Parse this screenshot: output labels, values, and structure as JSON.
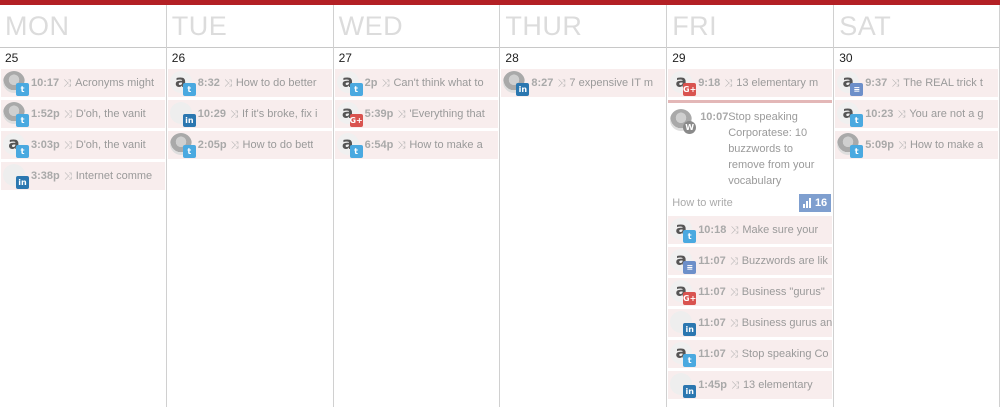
{
  "days": [
    {
      "name": "MON",
      "num": "25",
      "posts": [
        {
          "time": "10:17",
          "text": "Acronyms might",
          "avatar": "photo",
          "network": "twitter"
        },
        {
          "time": "1:52p",
          "text": "D'oh, the vanit",
          "avatar": "photo",
          "network": "twitter"
        },
        {
          "time": "3:03p",
          "text": "D'oh, the vanit",
          "avatar": "a",
          "network": "twitter"
        },
        {
          "time": "3:38p",
          "text": "Internet comme",
          "avatar": "logo",
          "network": "linkedin"
        }
      ]
    },
    {
      "name": "TUE",
      "num": "26",
      "posts": [
        {
          "time": "8:32",
          "text": "How to do better",
          "avatar": "a",
          "network": "twitter"
        },
        {
          "time": "10:29",
          "text": "If it's broke, fix i",
          "avatar": "logo",
          "network": "linkedin"
        },
        {
          "time": "2:05p",
          "text": "How to do bett",
          "avatar": "photo",
          "network": "twitter"
        }
      ]
    },
    {
      "name": "WED",
      "num": "27",
      "posts": [
        {
          "time": "2p",
          "text": "Can't think what to",
          "avatar": "a",
          "network": "twitter"
        },
        {
          "time": "5:39p",
          "text": "'Everything that",
          "avatar": "a",
          "network": "gplus"
        },
        {
          "time": "6:54p",
          "text": "How to make a",
          "avatar": "a",
          "network": "twitter"
        }
      ]
    },
    {
      "name": "THUR",
      "num": "28",
      "posts": [
        {
          "time": "8:27",
          "text": "7 expensive IT m",
          "avatar": "photo",
          "network": "linkedin"
        }
      ]
    },
    {
      "name": "FRI",
      "num": "29",
      "posts_before": [
        {
          "time": "9:18",
          "text": "13 elementary m",
          "avatar": "a",
          "network": "gplus"
        }
      ],
      "featured": {
        "time": "10:07",
        "text": "Stop speaking Corporatese: 10 buzzwords to remove from your vocabulary",
        "footer_label": "How to write",
        "stat": "16",
        "network": "wordpress"
      },
      "posts_after": [
        {
          "time": "10:18",
          "text": "Make sure your",
          "avatar": "a",
          "network": "twitter"
        },
        {
          "time": "11:07",
          "text": "Buzzwords are lik",
          "avatar": "a",
          "network": "buffer"
        },
        {
          "time": "11:07",
          "text": "Business \"gurus\"",
          "avatar": "a",
          "network": "gplus"
        },
        {
          "time": "11:07",
          "text": "Business gurus an",
          "avatar": "logo",
          "network": "linkedin"
        },
        {
          "time": "11:07",
          "text": "Stop speaking Co",
          "avatar": "a",
          "network": "twitter"
        },
        {
          "time": "1:45p",
          "text": "13 elementary",
          "avatar": "logo",
          "network": "linkedin"
        }
      ]
    },
    {
      "name": "SAT",
      "num": "30",
      "posts": [
        {
          "time": "9:37",
          "text": "The REAL trick t",
          "avatar": "a",
          "network": "buffer"
        },
        {
          "time": "10:23",
          "text": "You are not a g",
          "avatar": "a",
          "network": "twitter"
        },
        {
          "time": "5:09p",
          "text": "How to make a",
          "avatar": "photo",
          "network": "twitter"
        }
      ]
    }
  ],
  "colors": {
    "accent_bar": "#b32025",
    "post_bg": "#f8eded",
    "twitter": "#4aa9e0",
    "linkedin": "#2b77b0",
    "gplus": "#d9534f",
    "buffer": "#6d8fc9",
    "stat_bg": "#7f9fcf"
  }
}
